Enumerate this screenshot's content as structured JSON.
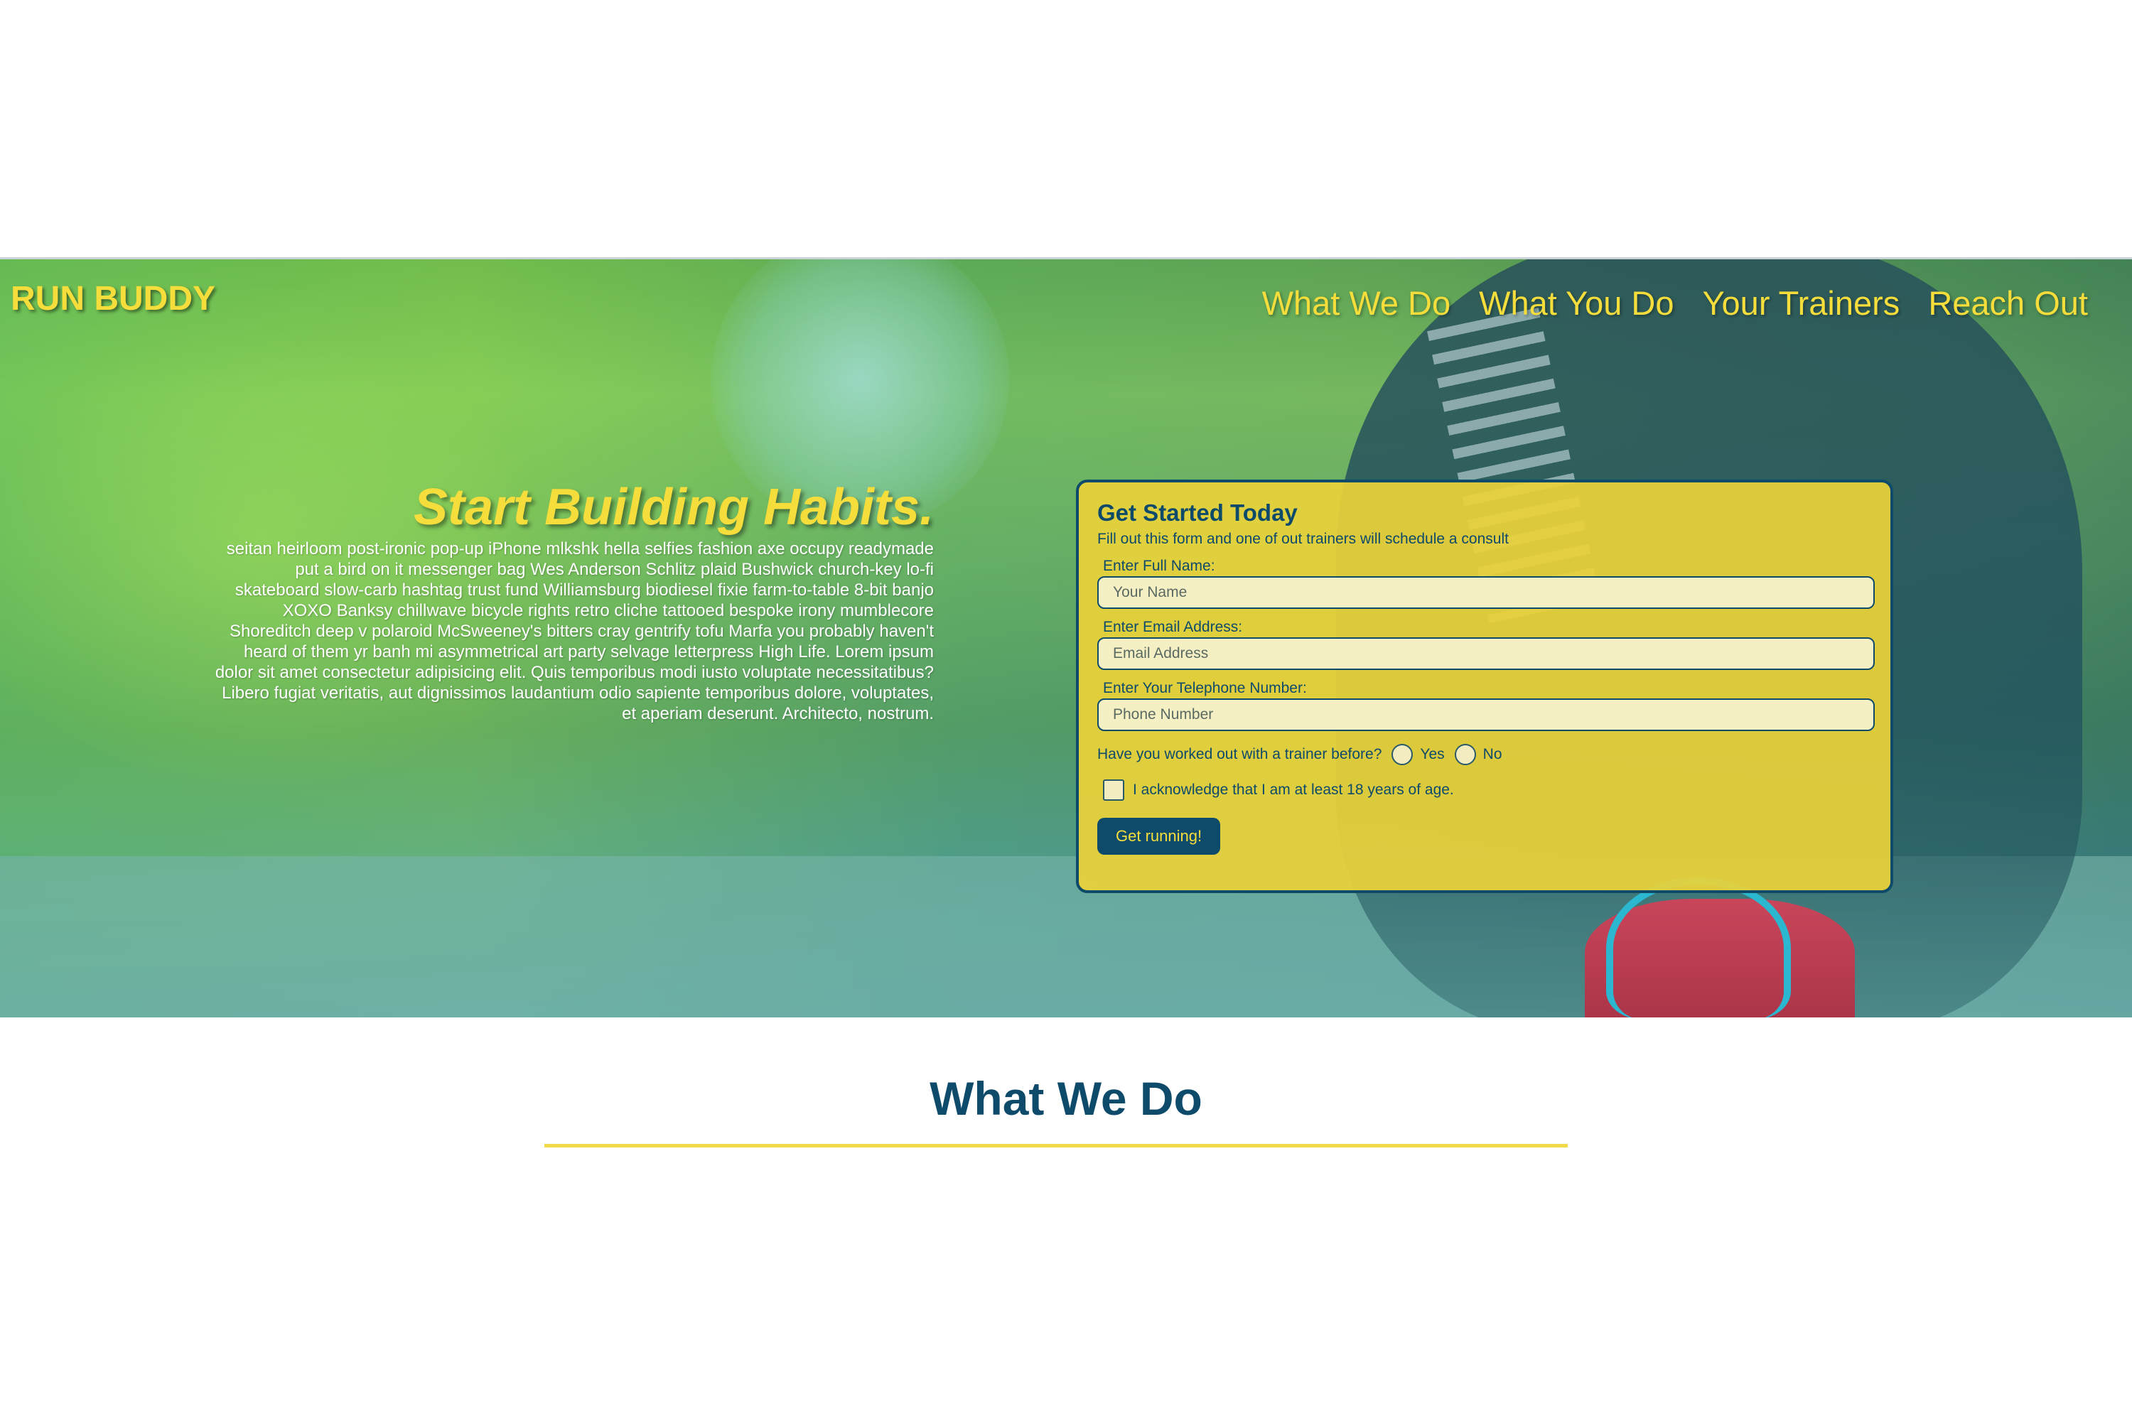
{
  "brand": {
    "logo": "RUN BUDDY"
  },
  "nav": {
    "items": [
      {
        "label": "What We Do"
      },
      {
        "label": "What You Do"
      },
      {
        "label": "Your Trainers"
      },
      {
        "label": "Reach Out"
      }
    ]
  },
  "hero": {
    "heading": "Start Building Habits.",
    "body": "seitan heirloom post-ironic pop-up iPhone mlkshk hella selfies fashion axe occupy readymade put a bird on it messenger bag Wes Anderson Schlitz plaid Bushwick church-key lo-fi skateboard slow-carb hashtag trust fund Williamsburg biodiesel fixie farm-to-table 8-bit banjo XOXO Banksy chillwave bicycle rights retro cliche tattooed bespoke irony mumblecore Shoreditch deep v polaroid McSweeney's bitters cray gentrify tofu Marfa you probably haven't heard of them yr banh mi asymmetrical art party selvage letterpress High Life. Lorem ipsum dolor sit amet consectetur adipisicing elit. Quis temporibus modi iusto voluptate necessitatibus? Libero fugiat veritatis, aut dignissimos laudantium odio sapiente temporibus dolore, voluptates, et aperiam deserunt. Architecto, nostrum."
  },
  "form": {
    "title": "Get Started Today",
    "subtitle": "Fill out this form and one of out trainers will schedule a consult",
    "name_label": "Enter Full Name:",
    "name_placeholder": "Your Name",
    "name_value": "",
    "email_label": "Enter Email Address:",
    "email_placeholder": "Email Address",
    "email_value": "",
    "phone_label": "Enter Your Telephone Number:",
    "phone_placeholder": "Phone Number",
    "phone_value": "",
    "trainer_question": "Have you worked out with a trainer before?",
    "yes_label": "Yes",
    "no_label": "No",
    "age_ack_label": "I acknowledge that I am at least 18 years of age.",
    "submit_label": "Get running!"
  },
  "sections": {
    "what_we_do_title": "What We Do"
  },
  "colors": {
    "brand_yellow": "#f5dd3c",
    "brand_navy": "#0e4a6a",
    "form_background": "#ecd23a",
    "input_background": "#f5f0c4",
    "rule_yellow": "#f2d94a"
  },
  "icons": {
    "radio": "radio-circle-icon",
    "checkbox": "checkbox-square-icon"
  }
}
